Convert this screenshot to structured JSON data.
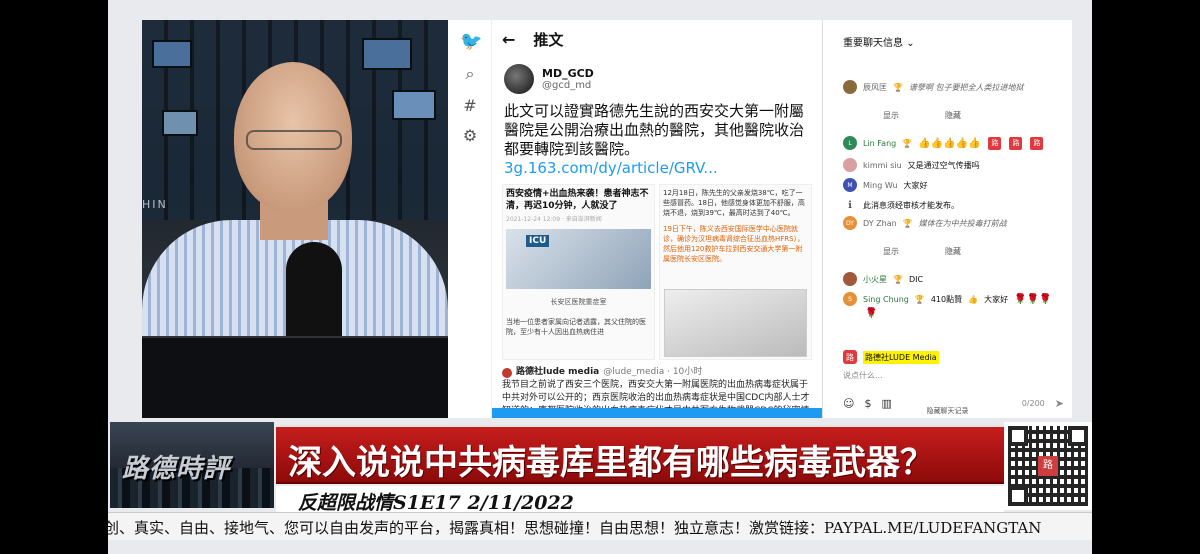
{
  "twitter": {
    "header_title": "推文",
    "author_name": "MD_GCD",
    "author_handle": "@gcd_md",
    "tweet_text": "此文可以證實路德先生說的西安交大第一附屬醫院是公開治療出血熱的醫院，其他醫院收治都要轉院到該醫院。",
    "tweet_link": "3g.163.com/dy/article/GRV...",
    "media_left": {
      "headline": "西安疫情+出血热来袭！患者神志不清，再迟10分钟，人就没了",
      "meta": "2021-12-24 12:09 · 来自澎湃新闻",
      "sign": "ICU",
      "caption": "长安区医院重症室",
      "body": "当地一位患者家属向记者透露，其父住院的医院，至少有十人因出血热病住进"
    },
    "media_right": {
      "p1": "12月18日，陈先生的父亲发烧38℃，吃了一些感冒药。18日，他感觉身体更加不舒服，高烧不退，烧到39℃，最高时达到了40℃。",
      "p2": "19日下午，陈义去西安国际医学中心医院就诊，确诊为汉坦病毒肾综合征出血热HFRS），然后他用120救护车拉到西安交通大学第一附属医院长安区医院。"
    },
    "quote": {
      "name": "路德社lude media",
      "handle": "@lude_media · 10小时",
      "text": "我节目之前说了西安三个医院，西安交大第一附属医院的出血热病毒症状属于中共对外可以公开的；西京医院收治的出血热病毒症状是中国CDC内部人士才知道的；唐都医院收治的出血热病毒症状才是中共军方生物武器CDC的秘密情报。三个医院的不同出血热症状的治疗方案是不一样的。"
    }
  },
  "chat": {
    "header": "重要聊天信息",
    "messages": [
      {
        "name": "辰风匡",
        "text": "谱孽啊 包子要把全人类拉进地狱",
        "style": "italic"
      },
      {
        "name": "Lin Fang",
        "text": "👍👍👍👍👍"
      },
      {
        "name": "kimmi siu",
        "text": "又是通过空气传播吗"
      },
      {
        "name": "Ming Wu",
        "text": "大家好"
      },
      {
        "name": "",
        "text": "此消息须经审核才能发布。"
      },
      {
        "name": "DY Zhan",
        "text": "媒体在为中共投毒打前战",
        "style": "italic"
      },
      {
        "name": "小火星",
        "text": "DIC"
      },
      {
        "name": "Sing Chung",
        "text": "410點贊",
        "text2": "大家好"
      }
    ],
    "show_label": "显示",
    "hide_label": "隐藏",
    "composer_name": "路德社LUDE Media",
    "composer_placeholder": "说点什么...",
    "char_count": "0/200",
    "hide_chat_label": "隐藏聊天记录"
  },
  "broadcast": {
    "brand": "路德時評",
    "headline": "深入说说中共病毒库里都有哪些病毒武器？",
    "subtitle": "反超限战情S1E17 2/11/2022",
    "ticker": "创、真实、自由、接地气、您可以自由发声的平台，揭露真相！思想碰撞！自由思想！独立意志！激赏链接：PAYPAL.ME/LUDEFANGTAN",
    "backdrop_text": "HIN",
    "qr_logo": "路"
  },
  "colors": {
    "headline_red": "#c61d1d",
    "twitter_blue": "#1d9bf0",
    "lude_red": "#e03a3e"
  }
}
